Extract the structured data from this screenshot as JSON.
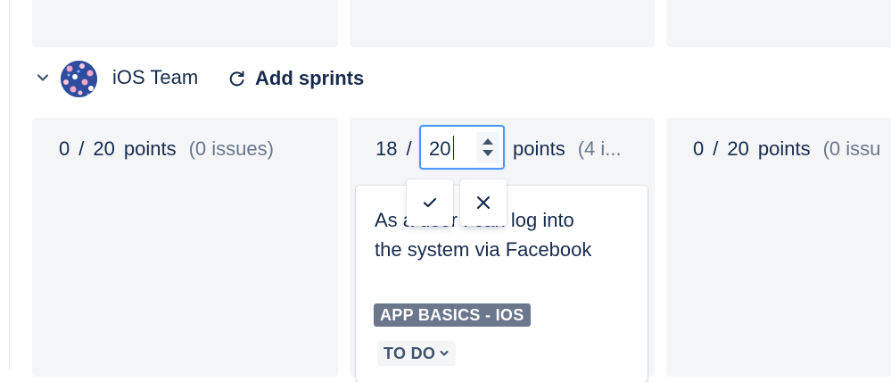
{
  "team": {
    "name": "iOS Team",
    "add_sprints_label": "Add sprints"
  },
  "columns": [
    {
      "done": "0",
      "sep": "/",
      "total": "20",
      "unit": "points",
      "issues": "(0 issues)"
    },
    {
      "done": "18",
      "sep": "/",
      "total_input": "20",
      "unit": "points",
      "issues": "(4 i..."
    },
    {
      "done": "0",
      "sep": "/",
      "total": "20",
      "unit": "points",
      "issues": "(0 issu"
    }
  ],
  "card": {
    "title": "As a user I can log into the system via Facebook",
    "epic": "APP BASICS - IOS",
    "status": "TO DO"
  },
  "colors": {
    "accent": "#4c9aff",
    "text": "#172b4d",
    "muted": "#6b778c",
    "column_bg": "#f4f5f7",
    "epic_bg": "#6b778c"
  }
}
